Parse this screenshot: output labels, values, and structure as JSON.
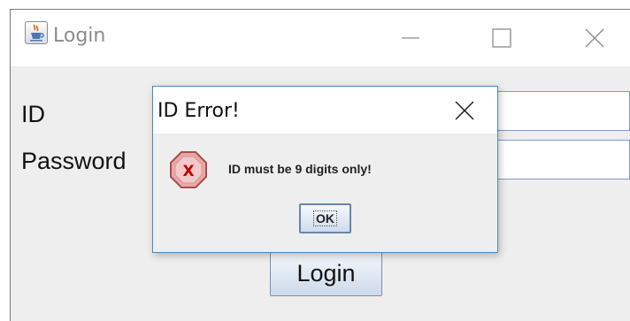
{
  "window": {
    "title": "Login",
    "app_icon": "java-cup-icon",
    "controls": [
      "minimize-icon",
      "maximize-icon",
      "close-icon"
    ]
  },
  "form": {
    "id_label": "ID",
    "password_label": "Password",
    "id_value": "",
    "password_value": "",
    "login_button": "Login"
  },
  "dialog": {
    "title": "ID Error!",
    "message": "ID must be 9 digits only!",
    "icon": "error-x-icon",
    "ok_button": "OK"
  }
}
